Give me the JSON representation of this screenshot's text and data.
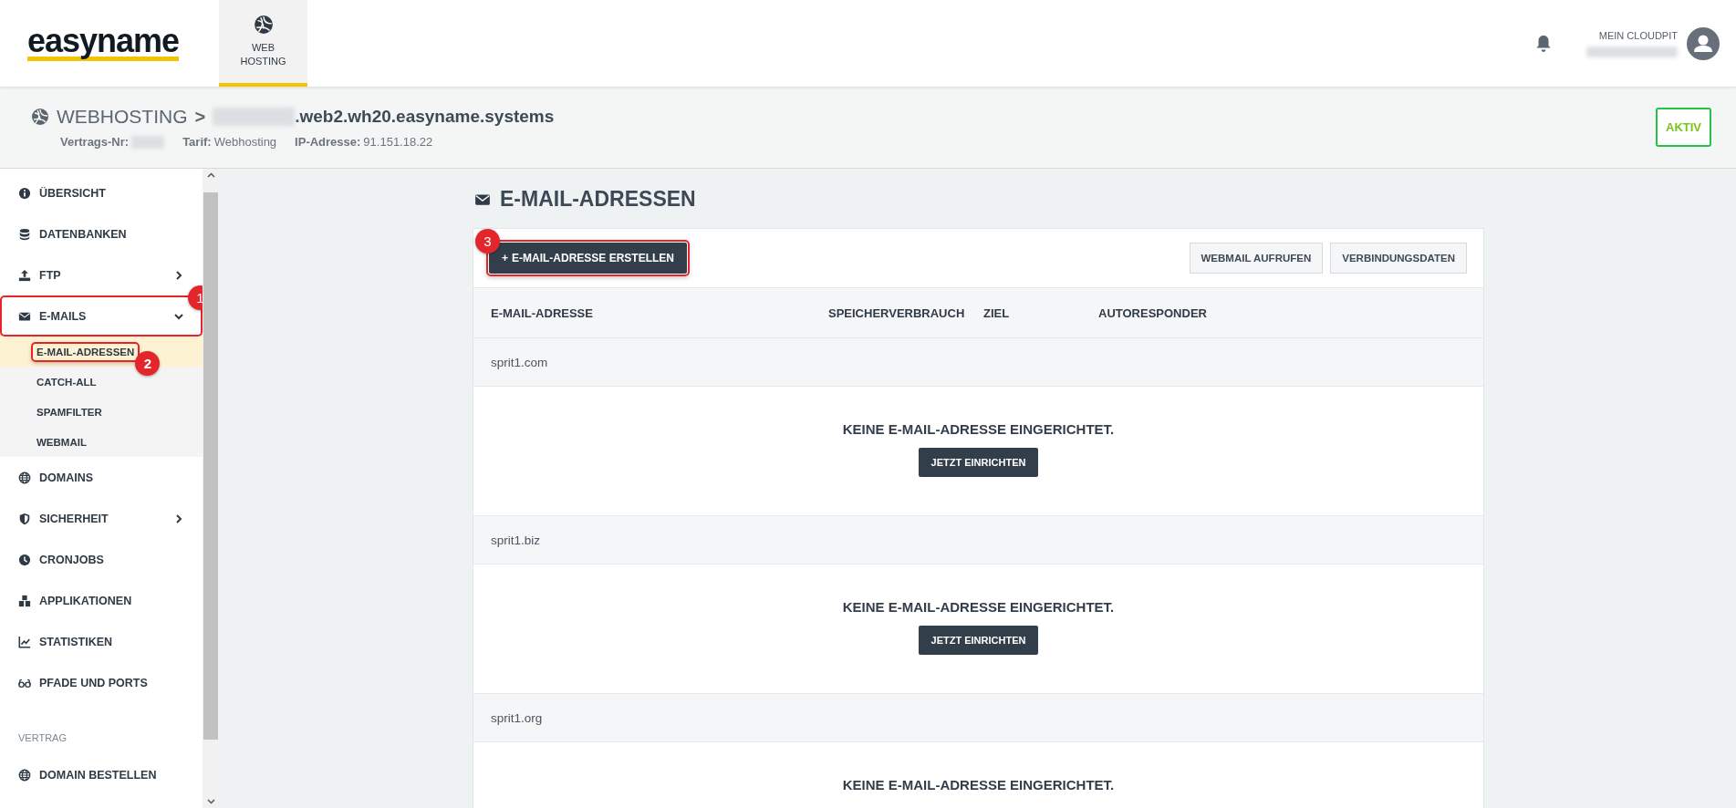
{
  "header": {
    "logo": "easyname",
    "nav": [
      {
        "label_lines": [
          "WEB",
          "HOSTING"
        ],
        "selected": true
      }
    ],
    "account_label": "MEIN CLOUDPIT"
  },
  "breadcrumb": {
    "section": "WEBHOSTING",
    "separator": ">",
    "host_suffix": ".web2.wh20.easyname.systems",
    "meta": [
      {
        "label": "Vertrags-Nr:",
        "blurred": true
      },
      {
        "label": "Tarif:",
        "value": "Webhosting"
      },
      {
        "label": "IP-Adresse:",
        "value": "91.151.18.22"
      }
    ],
    "status": "AKTIV"
  },
  "sidebar": {
    "items": [
      {
        "kind": "item",
        "label": "ÜBERSICHT"
      },
      {
        "kind": "item",
        "label": "DATENBANKEN"
      },
      {
        "kind": "group",
        "label": "FTP",
        "expanded": false
      },
      {
        "kind": "group",
        "label": "E-MAILS",
        "expanded": true,
        "callout": "1",
        "children": [
          {
            "label": "E-MAIL-ADRESSEN",
            "selected": true,
            "callout": "2"
          },
          {
            "label": "CATCH-ALL",
            "selected": false
          },
          {
            "label": "SPAMFILTER",
            "selected": false
          },
          {
            "label": "WEBMAIL",
            "selected": false
          }
        ]
      },
      {
        "kind": "item",
        "label": "DOMAINS"
      },
      {
        "kind": "group",
        "label": "SICHERHEIT",
        "expanded": false
      },
      {
        "kind": "item",
        "label": "CRONJOBS"
      },
      {
        "kind": "item",
        "label": "APPLIKATIONEN"
      },
      {
        "kind": "item",
        "label": "STATISTIKEN"
      },
      {
        "kind": "item",
        "label": "PFADE UND PORTS"
      },
      {
        "kind": "heading",
        "label": "VERTRAG"
      },
      {
        "kind": "item",
        "label": "DOMAIN BESTELLEN"
      }
    ]
  },
  "page": {
    "title": "E-MAIL-ADRESSEN",
    "create_button": {
      "icon": "+",
      "label": "E-MAIL-ADRESSE ERSTELLEN",
      "callout": "3"
    },
    "toolbar_buttons": [
      "WEBMAIL AUFRUFEN",
      "VERBINDUNGSDATEN"
    ],
    "table": {
      "columns": [
        "E-MAIL-ADRESSE",
        "SPEICHERVERBRAUCH",
        "ZIEL",
        "AUTORESPONDER"
      ],
      "groups": [
        {
          "domain": "sprit1.com",
          "message": "KEINE E-MAIL-ADRESSE EINGERICHTET.",
          "button": "JETZT EINRICHTEN"
        },
        {
          "domain": "sprit1.biz",
          "message": "KEINE E-MAIL-ADRESSE EINGERICHTET.",
          "button": "JETZT EINRICHTEN"
        },
        {
          "domain": "sprit1.org",
          "message": "KEINE E-MAIL-ADRESSE EINGERICHTET."
        }
      ]
    }
  }
}
